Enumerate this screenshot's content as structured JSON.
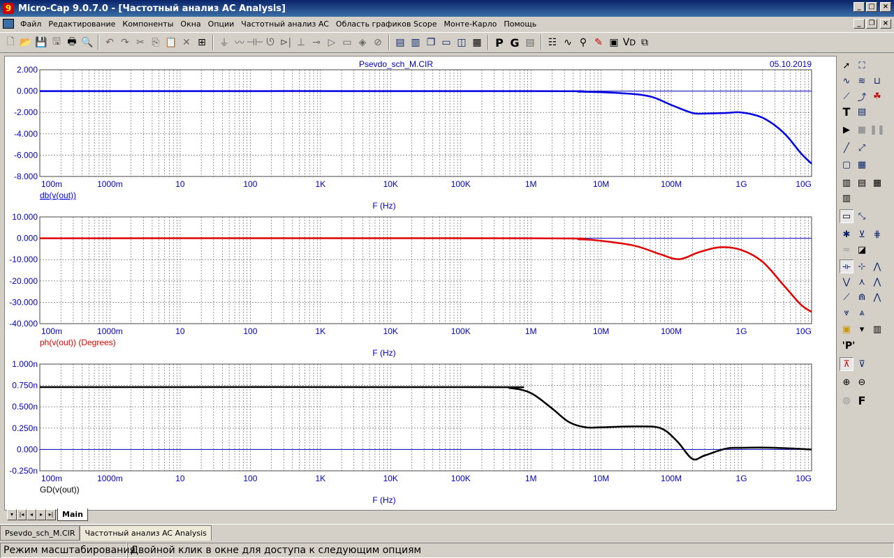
{
  "window": {
    "title": "Micro-Cap 9.0.7.0 - [Частотный анализ AC Analysis]"
  },
  "menu": [
    "Файл",
    "Редактирование",
    "Компоненты",
    "Окна",
    "Опции",
    "Частотный анализ AC",
    "Область графиков Scope",
    "Монте-Карло",
    "Помощь"
  ],
  "toolbar": {
    "icons": [
      "new-icon",
      "open-icon",
      "save-icon",
      "save-all-icon",
      "print-icon",
      "print-preview-icon",
      "undo-icon",
      "redo-icon",
      "cut-icon",
      "copy-icon",
      "paste-icon",
      "delete-icon",
      "select-all-icon",
      "ground-icon",
      "resistor-icon",
      "capacitor-icon",
      "inductor-icon",
      "diode-icon",
      "battery-icon",
      "source-icon",
      "opamp-icon",
      "jumper-icon",
      "node-icon",
      "npn-icon",
      "tile-horizontal-icon",
      "tile-vertical-icon",
      "cascade-icon",
      "window-icon",
      "split-icon",
      "calculator-icon"
    ],
    "p_label": "P",
    "g_label": "G"
  },
  "plot": {
    "file": "Psevdo_sch_M.CIR",
    "date": "05.10.2019",
    "x_ticks": [
      "100m",
      "1000m",
      "10",
      "100",
      "1K",
      "10K",
      "100K",
      "1M",
      "10M",
      "100M",
      "1G",
      "10G"
    ],
    "x_label": "F (Hz)",
    "color_primary": "#0000c0"
  },
  "chart_data": [
    {
      "type": "line",
      "title": "",
      "xlabel": "F (Hz)",
      "ylabel": "db(v(out))",
      "xscale": "log",
      "xlim": [
        0.1,
        10000000000
      ],
      "ylim": [
        -8,
        2
      ],
      "y_ticks": [
        "2.000",
        "0.000",
        "-2.000",
        "-4.000",
        "-6.000",
        "-8.000"
      ],
      "color": "#0000e0",
      "series": [
        {
          "name": "db(v(out))",
          "x": [
            0.1,
            1000000,
            5000000,
            20000000,
            50000000,
            100000000,
            200000000,
            300000000,
            600000000,
            1000000000,
            2000000000,
            4000000000,
            7000000000,
            10000000000
          ],
          "y": [
            0,
            0,
            -0.05,
            -0.2,
            -0.5,
            -1.3,
            -2.05,
            -2.1,
            -2.05,
            -2.0,
            -2.5,
            -3.9,
            -5.8,
            -6.8
          ]
        }
      ]
    },
    {
      "type": "line",
      "title": "",
      "xlabel": "F (Hz)",
      "ylabel": "ph(v(out)) (Degrees)",
      "xscale": "log",
      "xlim": [
        0.1,
        10000000000
      ],
      "ylim": [
        -40,
        10
      ],
      "y_ticks": [
        "10.000",
        "0.000",
        "-10.000",
        "-20.000",
        "-30.000",
        "-40.000"
      ],
      "color": "#e00000",
      "series": [
        {
          "name": "ph(v(out)) (Degrees)",
          "x": [
            0.1,
            1000000,
            5000000,
            10000000,
            30000000,
            70000000,
            130000000,
            250000000,
            500000000,
            1000000000,
            2000000000,
            4000000000,
            7000000000,
            10000000000
          ],
          "y": [
            0,
            0,
            -0.5,
            -1.2,
            -3.5,
            -7.5,
            -9.8,
            -6.5,
            -4.2,
            -5.5,
            -11,
            -22,
            -31,
            -34.5
          ]
        }
      ]
    },
    {
      "type": "line",
      "title": "",
      "xlabel": "F (Hz)",
      "ylabel": "GD(v(out))",
      "xscale": "log",
      "xlim": [
        0.1,
        10000000000
      ],
      "ylim": [
        -0.25,
        1
      ],
      "y_ticks": [
        "1.000n",
        "0.750n",
        "0.500n",
        "0.250n",
        "0.000",
        "-0.250n"
      ],
      "color": "#000000",
      "series": [
        {
          "name": "GD(v(out))",
          "x": [
            0.1,
            200000,
            500000,
            1000000,
            2000000,
            3500000,
            6000000,
            10000000,
            30000000,
            70000000,
            120000000,
            200000000,
            300000000,
            600000000,
            1000000000,
            3000000000,
            10000000000
          ],
          "y": [
            0.73,
            0.73,
            0.72,
            0.66,
            0.48,
            0.32,
            0.26,
            0.26,
            0.27,
            0.25,
            0.1,
            -0.11,
            -0.07,
            0.01,
            0.02,
            0.02,
            0.0
          ]
        }
      ]
    }
  ],
  "right_panel": {
    "icons": [
      "pointer-icon",
      "zoom-select-icon",
      "wave-icon",
      "wave2-icon",
      "graph-icon",
      "step-icon",
      "text-icon",
      "info-icon",
      "run-icon",
      "stop-icon",
      "pause-icon",
      "line-icon",
      "line2-icon",
      "grid-icon",
      "grid2-icon",
      "layout-icon",
      "layout2-icon",
      "layout3-icon",
      "axis-icon",
      "axis2-icon",
      "peak-icon",
      "valley-icon",
      "high-icon",
      "low-icon",
      "inflection-icon",
      "slope-icon",
      "tracker-icon",
      "tracker2-icon",
      "chip-icon",
      "table-icon",
      "p-icon",
      "cursor-icon",
      "cursor2-icon",
      "zoom-in-icon",
      "zoom-out-icon",
      "color-icon",
      "f-icon"
    ],
    "p_label": "'P'",
    "f_label": "F"
  },
  "sheet_tab": {
    "label": "Main"
  },
  "doc_tabs": [
    "Psevdo_sch_M.CIR",
    "Частотный анализ AC Analysis"
  ],
  "status": {
    "mode": "Режим масштабирования",
    "hint": "Двойной клик в окне для доступа к следующим опциям"
  }
}
